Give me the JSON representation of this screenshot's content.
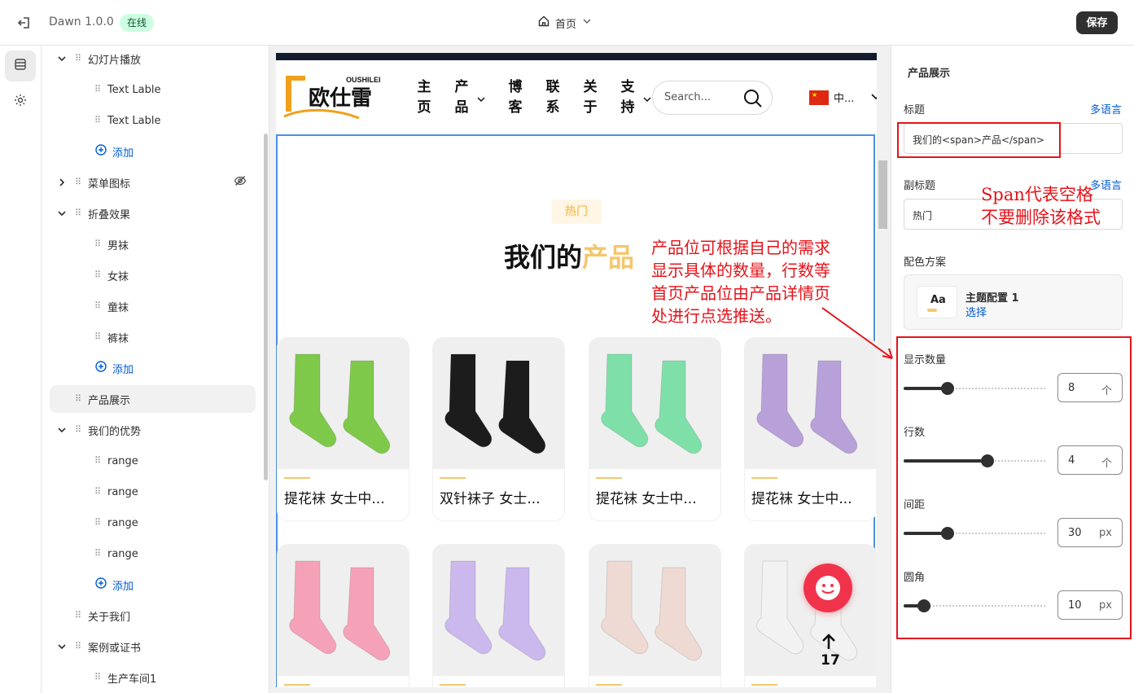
{
  "topbar": {
    "app_name": "Dawn 1.0.0",
    "status": "在线",
    "page": "首页",
    "save": "保存"
  },
  "tree": {
    "items": [
      {
        "label": "幻灯片播放"
      },
      {
        "label": "Text Lable"
      },
      {
        "label": "Text Lable"
      },
      {
        "label": "添加"
      },
      {
        "label": "菜单图标"
      },
      {
        "label": "折叠效果"
      },
      {
        "label": "男袜"
      },
      {
        "label": "女袜"
      },
      {
        "label": "童袜"
      },
      {
        "label": "裤袜"
      },
      {
        "label": "添加"
      },
      {
        "label": "产品展示"
      },
      {
        "label": "我们的优势"
      },
      {
        "label": "range"
      },
      {
        "label": "range"
      },
      {
        "label": "range"
      },
      {
        "label": "range"
      },
      {
        "label": "添加"
      },
      {
        "label": "关于我们"
      },
      {
        "label": "案例或证书"
      },
      {
        "label": "生产车间1"
      }
    ]
  },
  "preview": {
    "logo_top": "OUSHILEI",
    "logo_main": "欧仕雷",
    "nav": [
      "主页",
      "产品",
      "博客",
      "联系",
      "关于",
      "支持"
    ],
    "search_placeholder": "Search...",
    "lang": "中...",
    "tag": "热门",
    "heading_main": "我们的",
    "heading_accent": "产品",
    "products": [
      {
        "title": "提花袜 女士中...",
        "color": "#7fc94a"
      },
      {
        "title": "双针袜子 女士...",
        "color": "#1c1c1c"
      },
      {
        "title": "提花袜 女士中...",
        "color": "#7ee0a8"
      },
      {
        "title": "提花袜 女士中...",
        "color": "#b8a0d8"
      },
      {
        "title": "",
        "color": "#f5a2b8"
      },
      {
        "title": "",
        "color": "#cbb8ec"
      },
      {
        "title": "",
        "color": "#efd9d3"
      },
      {
        "title": "",
        "color": "#f2f2f2"
      }
    ],
    "scroll_count": "17"
  },
  "panel": {
    "title": "产品展示",
    "title_label": "标题",
    "multilang": "多语言",
    "title_value": "我们的<span>产品</span>",
    "subtitle_label": "副标题",
    "subtitle_multilang": "多语言",
    "subtitle_value": "热门",
    "color_label": "配色方案",
    "theme_aa": "Aa",
    "theme_name": "主题配置 1",
    "theme_select": "选择",
    "sliders": [
      {
        "label": "显示数量",
        "value": "8",
        "unit": "个",
        "fraction": 0.31
      },
      {
        "label": "行数",
        "value": "4",
        "unit": "个",
        "fraction": 0.59
      },
      {
        "label": "间距",
        "value": "30",
        "unit": "px",
        "fraction": 0.31
      },
      {
        "label": "圆角",
        "value": "10",
        "unit": "px",
        "fraction": 0.14
      }
    ]
  },
  "annotations": {
    "span_note_1": "Span代表空格",
    "span_note_2": "不要删除该格式",
    "product_note": [
      "产品位可根据自己的需求",
      "显示具体的数量，行数等",
      "首页产品位由产品详情页",
      "处进行点选推送。"
    ]
  }
}
